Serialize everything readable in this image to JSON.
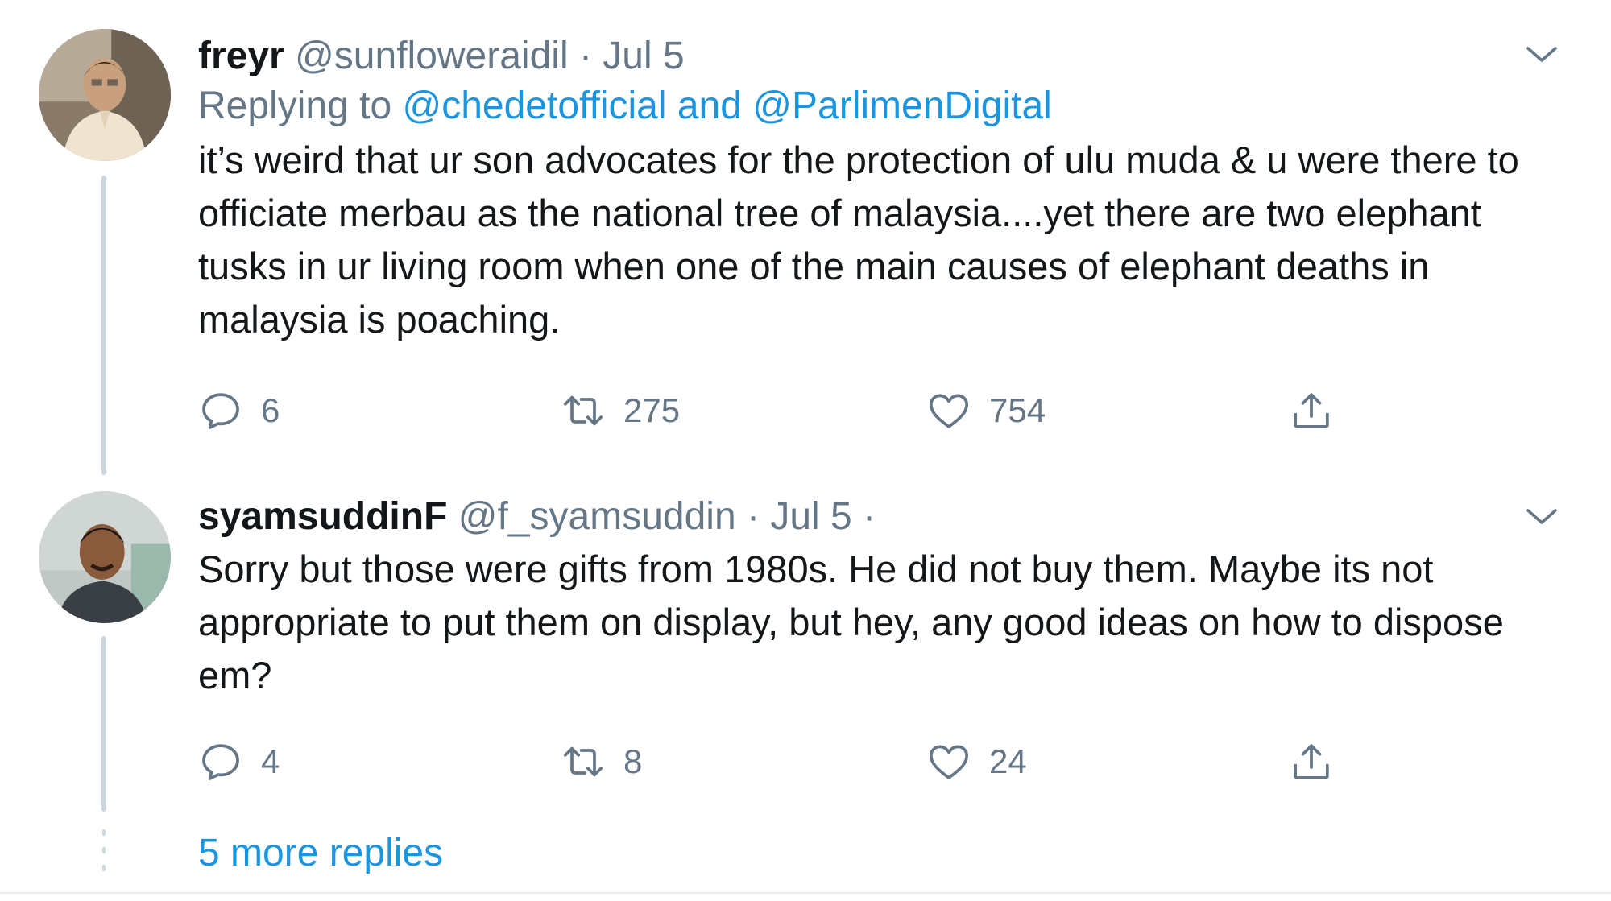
{
  "tweets": [
    {
      "display_name": "freyr",
      "handle": "@sunfloweraidil",
      "separator": "·",
      "date": "Jul 5",
      "reply_prefix": "Replying to",
      "reply_mention_1": "@chedetofficial",
      "reply_and": "and",
      "reply_mention_2": "@ParlimenDigital",
      "text": "it’s weird that ur son advocates for the protection of ulu muda & u were there to officiate merbau as the national tree of malaysia....yet there are two elephant tusks in ur living room when one of the main causes of elephant deaths in malaysia is poaching.",
      "reply_count": "6",
      "retweet_count": "275",
      "like_count": "754",
      "avatar_icon": "avatar-photo-icon"
    },
    {
      "display_name": "syamsuddinF",
      "handle": "@f_syamsuddin",
      "separator": "·",
      "date": "Jul 5",
      "trailing_separator": "·",
      "text": "Sorry but those were gifts from 1980s. He did not buy them. Maybe its not appropriate to put them on display, but hey, any good ideas on how to dispose em?",
      "reply_count": "4",
      "retweet_count": "8",
      "like_count": "24",
      "avatar_icon": "avatar-photo-icon"
    }
  ],
  "more_replies": "5 more replies",
  "icons": {
    "reply": "reply-icon",
    "retweet": "retweet-icon",
    "like": "heart-icon",
    "share": "share-icon",
    "menu": "chevron-down-icon"
  },
  "colors": {
    "text_primary": "#14171a",
    "text_secondary": "#657786",
    "link": "#1b95e0",
    "thread_line": "#ccd6dd"
  }
}
